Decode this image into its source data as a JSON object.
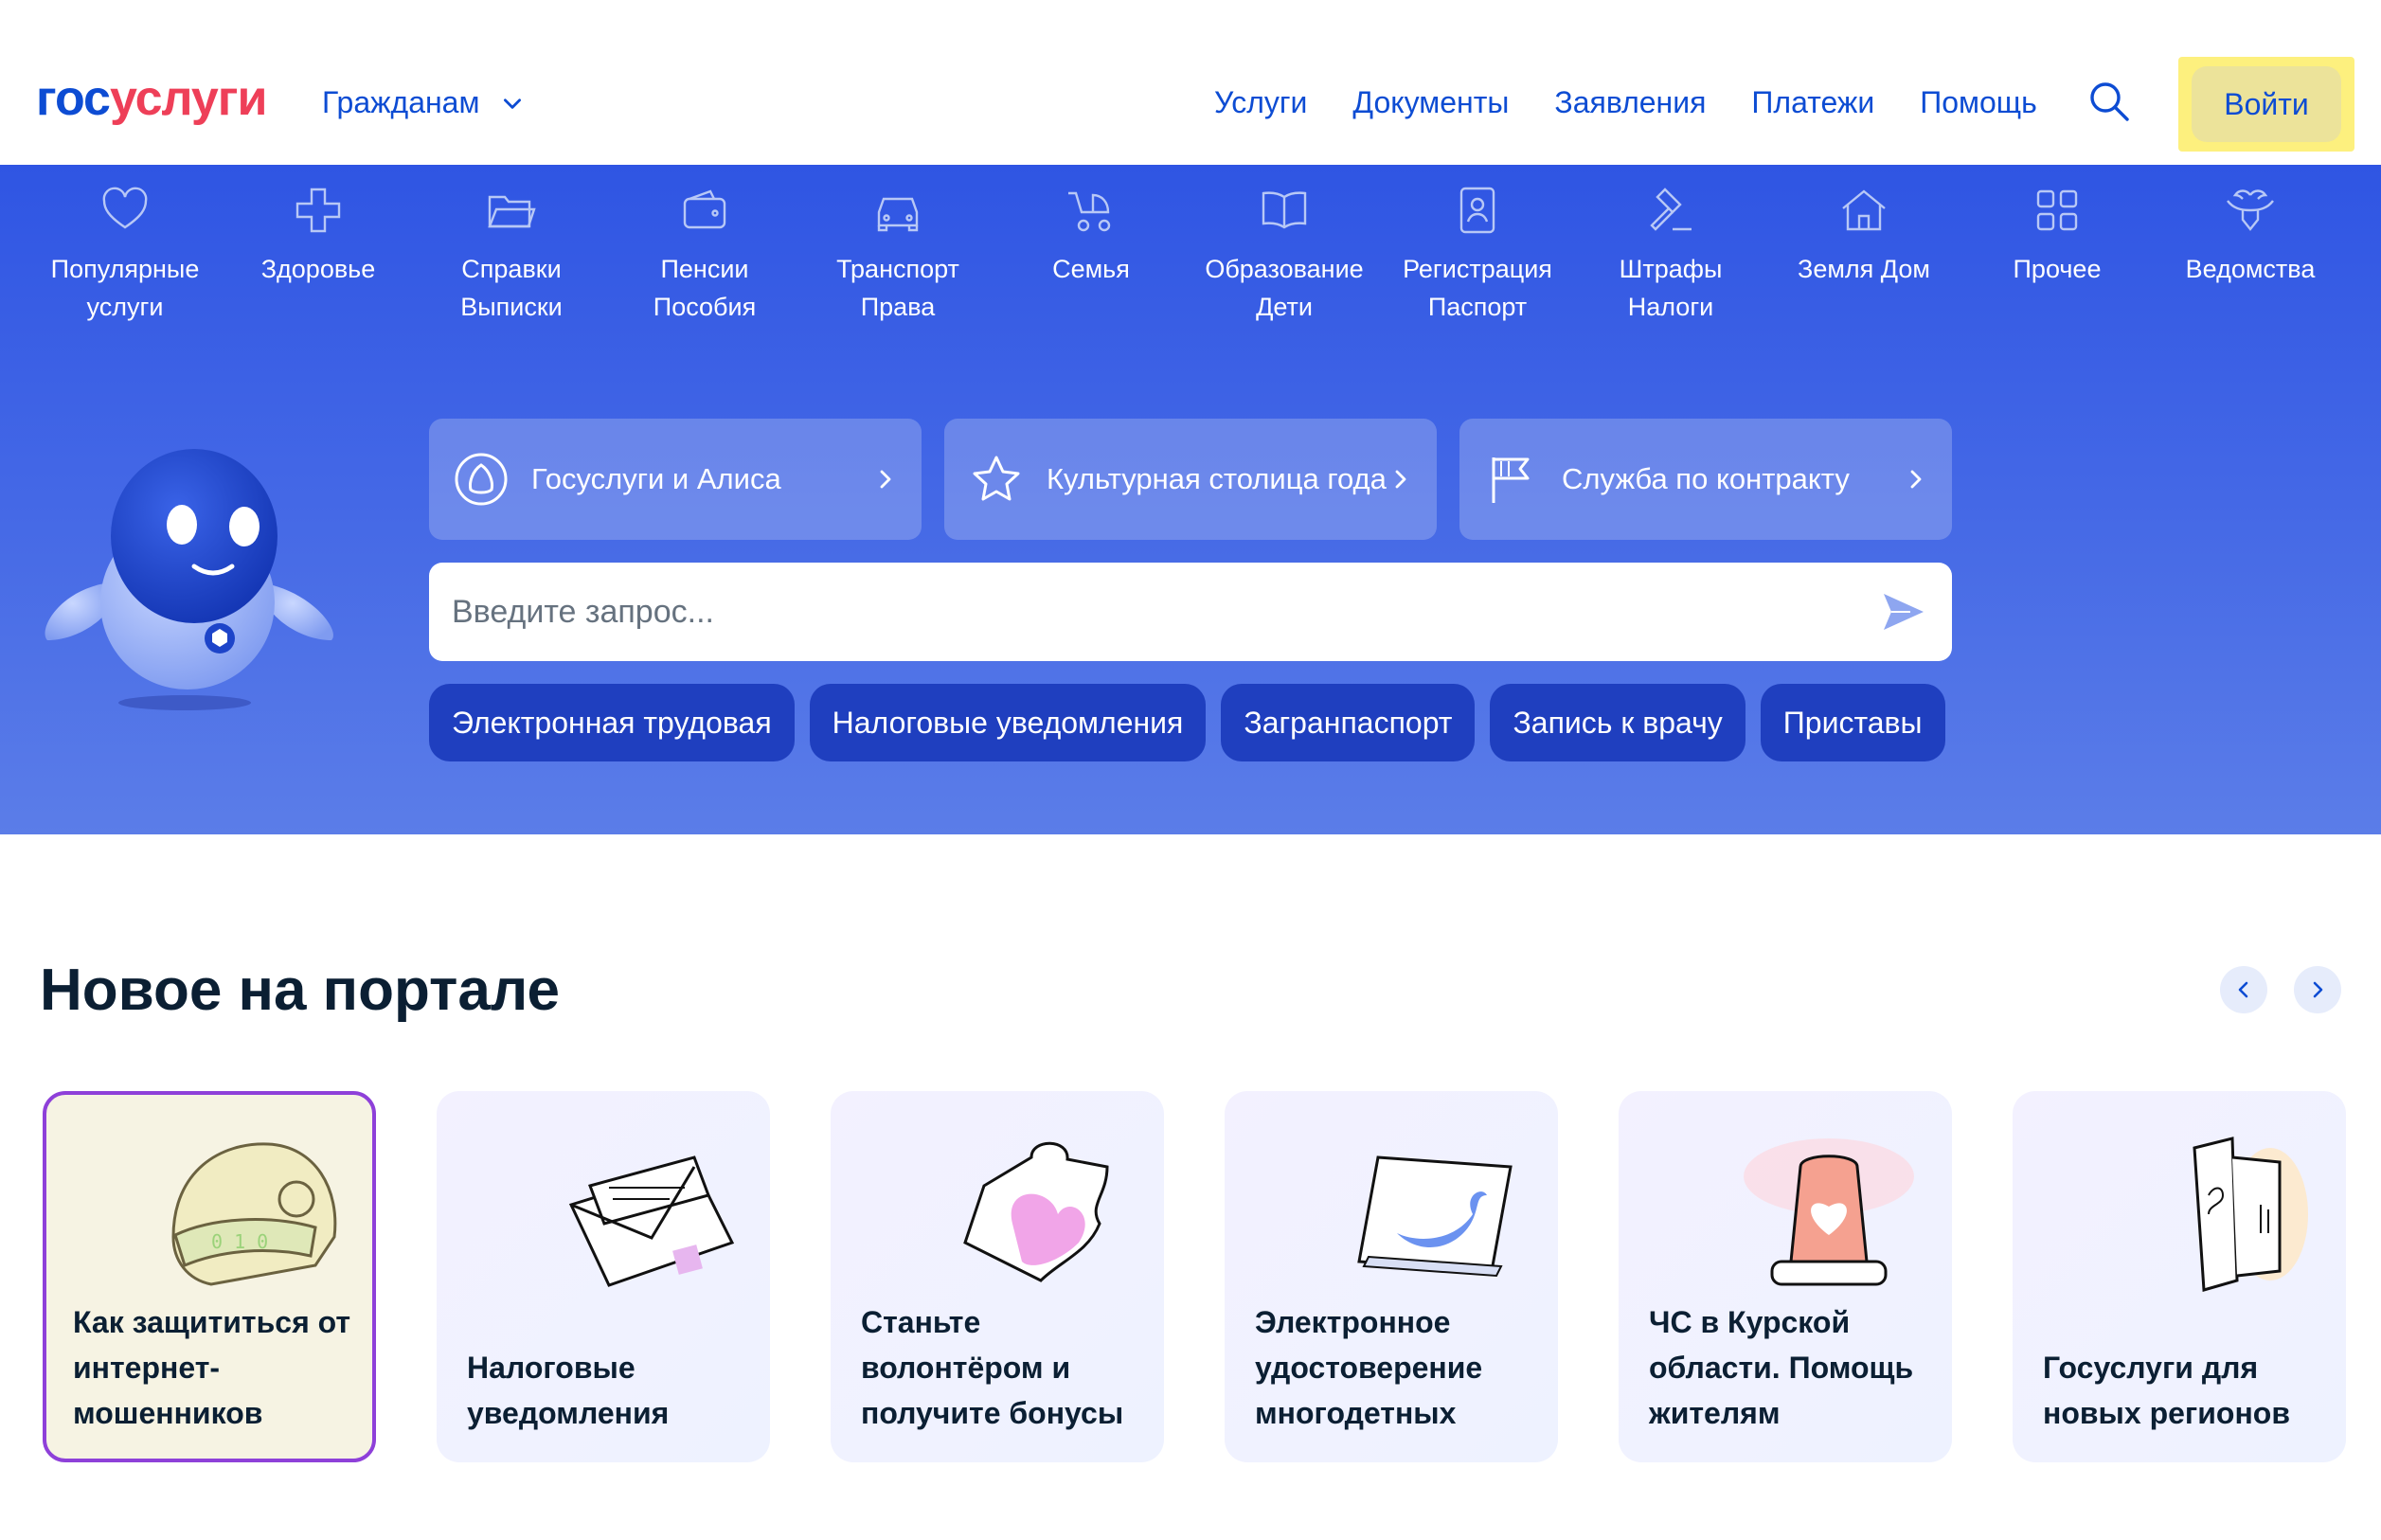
{
  "header": {
    "logo_part1": "гос",
    "logo_part2": "услуги",
    "audience": "Гражданам",
    "nav": [
      "Услуги",
      "Документы",
      "Заявления",
      "Платежи",
      "Помощь"
    ],
    "login": "Войти"
  },
  "categories": [
    {
      "icon": "heart-icon",
      "label": "Популярные услуги"
    },
    {
      "icon": "medical-cross-icon",
      "label": "Здоровье"
    },
    {
      "icon": "folder-icon",
      "label": "Справки Выписки"
    },
    {
      "icon": "wallet-icon",
      "label": "Пенсии Пособия"
    },
    {
      "icon": "car-icon",
      "label": "Транспорт Права"
    },
    {
      "icon": "stroller-icon",
      "label": "Семья"
    },
    {
      "icon": "book-icon",
      "label": "Образование Дети"
    },
    {
      "icon": "id-card-icon",
      "label": "Регистрация Паспорт"
    },
    {
      "icon": "gavel-icon",
      "label": "Штрафы Налоги"
    },
    {
      "icon": "house-icon",
      "label": "Земля Дом"
    },
    {
      "icon": "grid-icon",
      "label": "Прочее"
    },
    {
      "icon": "emblem-icon",
      "label": "Ведомства"
    }
  ],
  "promos": [
    {
      "icon": "alice-icon",
      "label": "Госуслуги и Алиса"
    },
    {
      "icon": "star-icon",
      "label": "Культурная столица года"
    },
    {
      "icon": "flag-icon",
      "label": "Служба по контракту"
    }
  ],
  "search": {
    "placeholder": "Введите запрос..."
  },
  "chips": [
    "Электронная трудовая",
    "Налоговые уведомления",
    "Загранпаспорт",
    "Запись к врачу",
    "Приставы"
  ],
  "new_section": {
    "title": "Новое на портале",
    "cards": [
      {
        "label": "Как защититься от интернет-мошенников",
        "icon": "helmet-icon"
      },
      {
        "label": "Налоговые уведомления",
        "icon": "envelope-icon"
      },
      {
        "label": "Станьте волонтёром и получите бонусы",
        "icon": "puzzle-icon"
      },
      {
        "label": "Электронное удостоверение многодетных",
        "icon": "certificate-icon"
      },
      {
        "label": "ЧС в Курской области. Помощь жителям",
        "icon": "alarm-icon"
      },
      {
        "label": "Госуслуги для новых регионов",
        "icon": "door-icon"
      }
    ]
  },
  "colors": {
    "brand_blue": "#0d4cd3",
    "brand_red": "#ee3f58",
    "hero_blue": "#2f55e3",
    "chip_blue": "#1f3fbf",
    "focus_purple": "#8e40d9"
  }
}
